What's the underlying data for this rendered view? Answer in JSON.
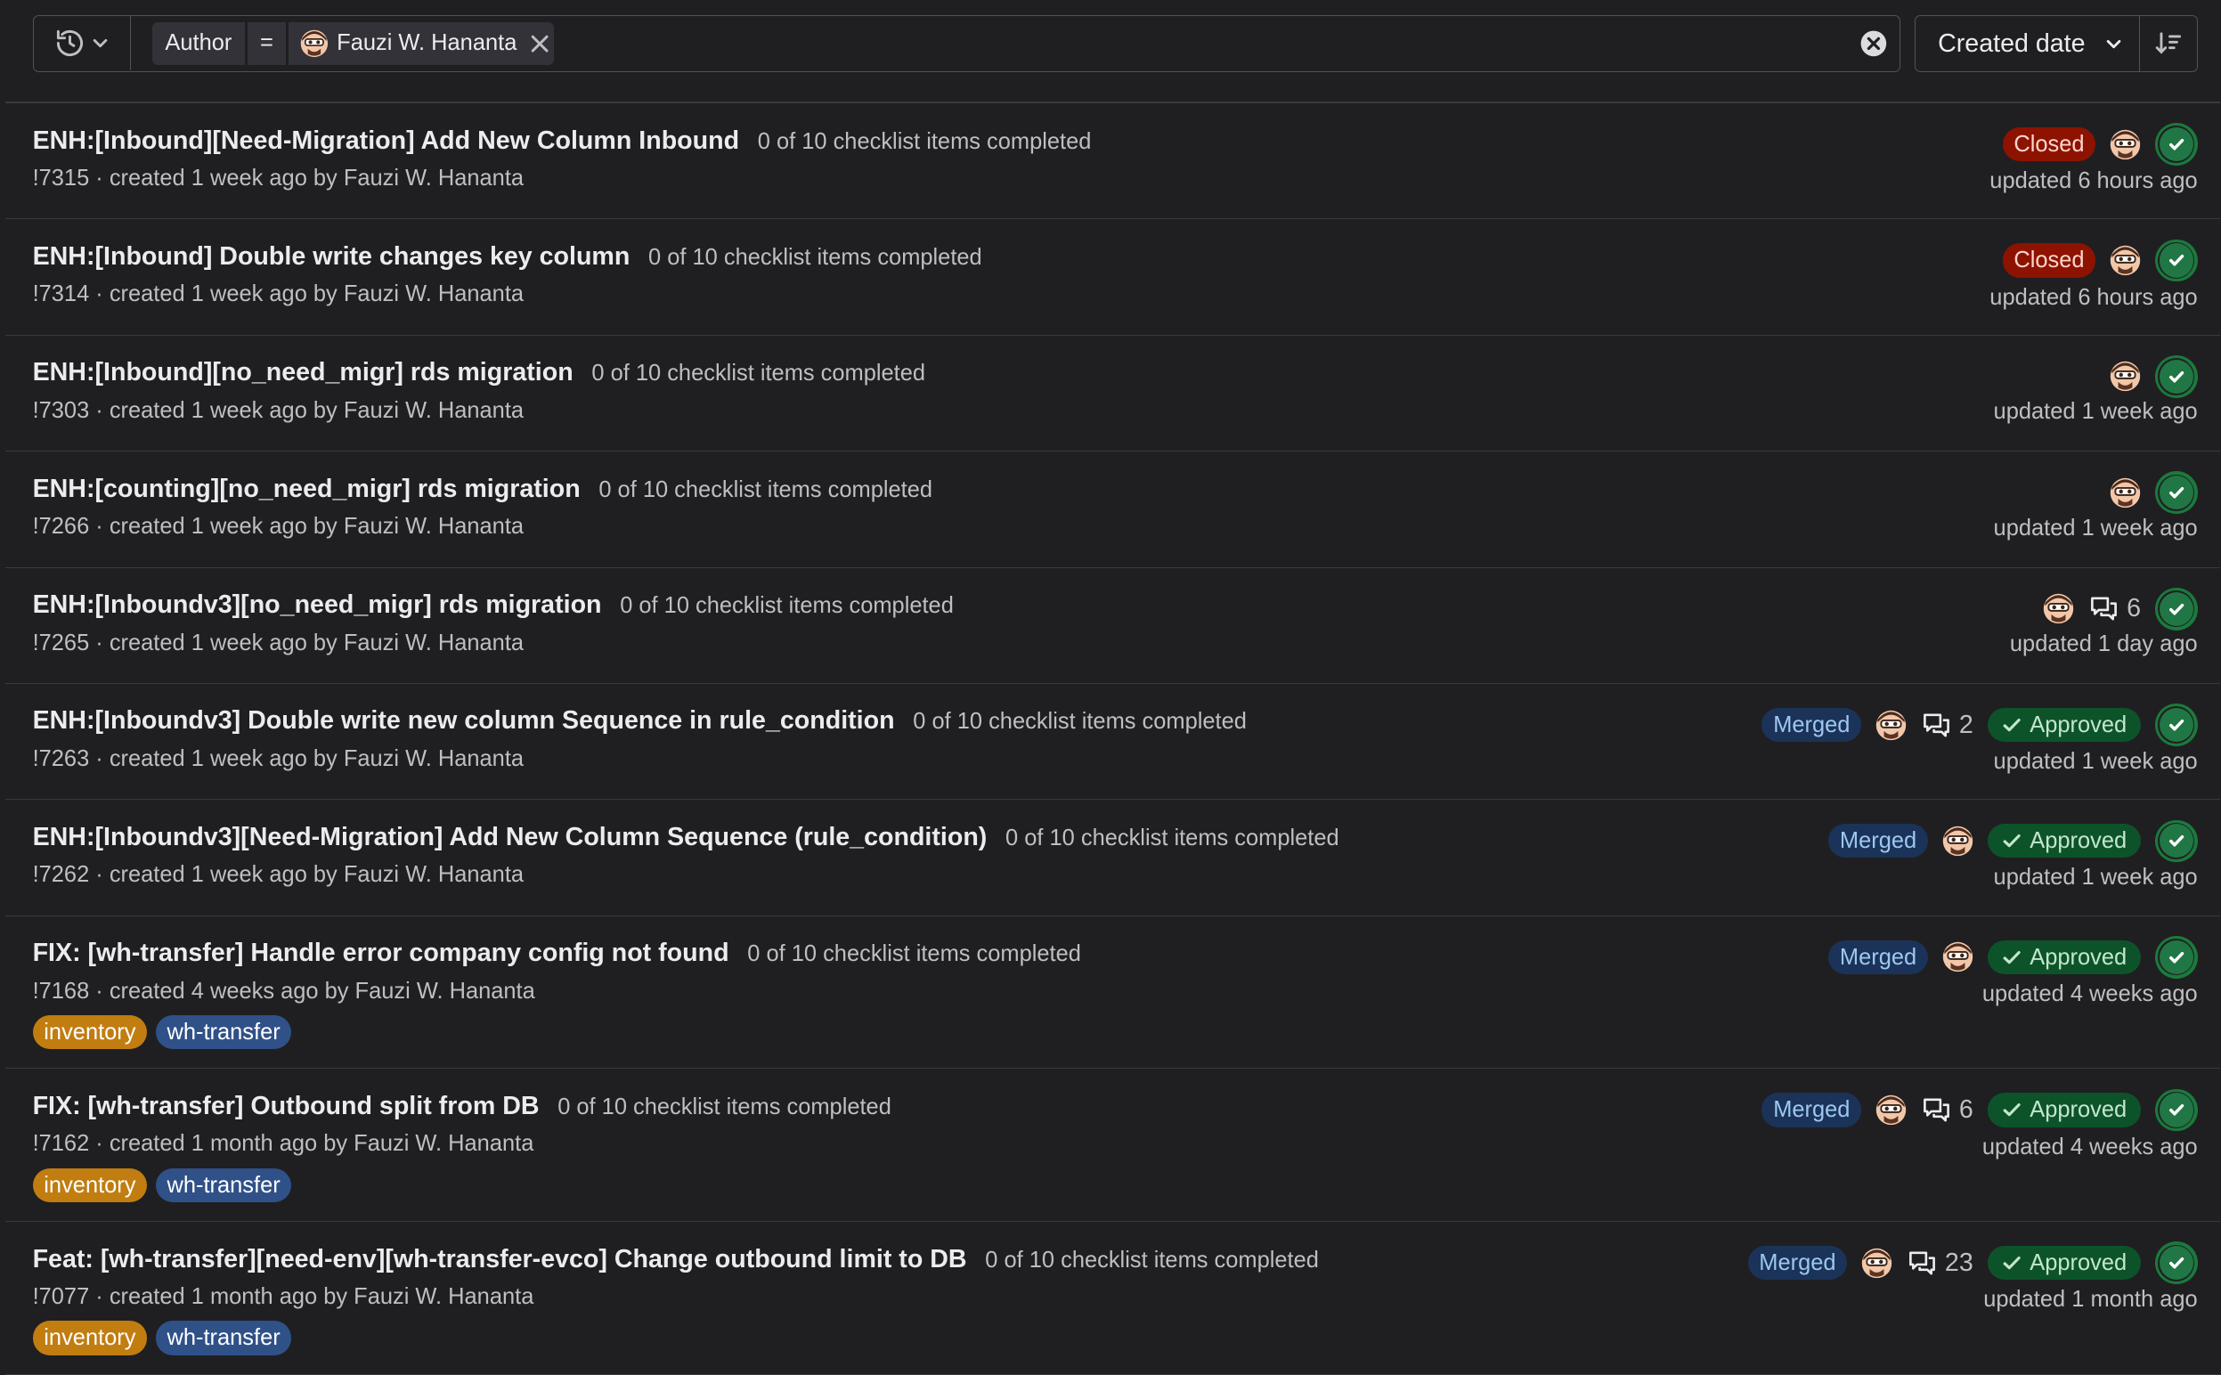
{
  "filter": {
    "token_key": "Author",
    "token_operator": "=",
    "token_value": "Fauzi W. Hananta"
  },
  "sort": {
    "label": "Created date"
  },
  "merge_requests": [
    {
      "title": "ENH:[Inbound][Need-Migration] Add New Column Inbound",
      "checklist": "0 of 10 checklist items completed",
      "meta": "!7315 · created 1 week ago by Fauzi W. Hananta",
      "status": "Closed",
      "comments": "",
      "approved": "",
      "updated": "updated 6 hours ago",
      "labels": []
    },
    {
      "title": "ENH:[Inbound] Double write changes key column",
      "checklist": "0 of 10 checklist items completed",
      "meta": "!7314 · created 1 week ago by Fauzi W. Hananta",
      "status": "Closed",
      "comments": "",
      "approved": "",
      "updated": "updated 6 hours ago",
      "labels": []
    },
    {
      "title": "ENH:[Inbound][no_need_migr] rds migration",
      "checklist": "0 of 10 checklist items completed",
      "meta": "!7303 · created 1 week ago by Fauzi W. Hananta",
      "status": "",
      "comments": "",
      "approved": "",
      "updated": "updated 1 week ago",
      "labels": []
    },
    {
      "title": "ENH:[counting][no_need_migr] rds migration",
      "checklist": "0 of 10 checklist items completed",
      "meta": "!7266 · created 1 week ago by Fauzi W. Hananta",
      "status": "",
      "comments": "",
      "approved": "",
      "updated": "updated 1 week ago",
      "labels": []
    },
    {
      "title": "ENH:[Inboundv3][no_need_migr] rds migration",
      "checklist": "0 of 10 checklist items completed",
      "meta": "!7265 · created 1 week ago by Fauzi W. Hananta",
      "status": "",
      "comments": "6",
      "approved": "",
      "updated": "updated 1 day ago",
      "labels": []
    },
    {
      "title": "ENH:[Inboundv3] Double write new column Sequence in rule_condition",
      "checklist": "0 of 10 checklist items completed",
      "meta": "!7263 · created 1 week ago by Fauzi W. Hananta",
      "status": "Merged",
      "comments": "2",
      "approved": "Approved",
      "updated": "updated 1 week ago",
      "labels": []
    },
    {
      "title": "ENH:[Inboundv3][Need-Migration] Add New Column Sequence (rule_condition)",
      "checklist": "0 of 10 checklist items completed",
      "meta": "!7262 · created 1 week ago by Fauzi W. Hananta",
      "status": "Merged",
      "comments": "",
      "approved": "Approved",
      "updated": "updated 1 week ago",
      "labels": []
    },
    {
      "title": "FIX: [wh-transfer] Handle error company config not found",
      "checklist": "0 of 10 checklist items completed",
      "meta": "!7168 · created 4 weeks ago by Fauzi W. Hananta",
      "status": "Merged",
      "comments": "",
      "approved": "Approved",
      "updated": "updated 4 weeks ago",
      "labels": [
        {
          "text": "inventory",
          "color": "#c17d10"
        },
        {
          "text": "wh-transfer",
          "color": "#2f5188"
        }
      ]
    },
    {
      "title": "FIX: [wh-transfer] Outbound split from DB",
      "checklist": "0 of 10 checklist items completed",
      "meta": "!7162 · created 1 month ago by Fauzi W. Hananta",
      "status": "Merged",
      "comments": "6",
      "approved": "Approved",
      "updated": "updated 4 weeks ago",
      "labels": [
        {
          "text": "inventory",
          "color": "#c17d10"
        },
        {
          "text": "wh-transfer",
          "color": "#2f5188"
        }
      ]
    },
    {
      "title": "Feat: [wh-transfer][need-env][wh-transfer-evco] Change outbound limit to DB",
      "checklist": "0 of 10 checklist items completed",
      "meta": "!7077 · created 1 month ago by Fauzi W. Hananta",
      "status": "Merged",
      "comments": "23",
      "approved": "Approved",
      "updated": "updated 1 month ago",
      "labels": [
        {
          "text": "inventory",
          "color": "#c17d10"
        },
        {
          "text": "wh-transfer",
          "color": "#2f5188"
        }
      ]
    }
  ]
}
